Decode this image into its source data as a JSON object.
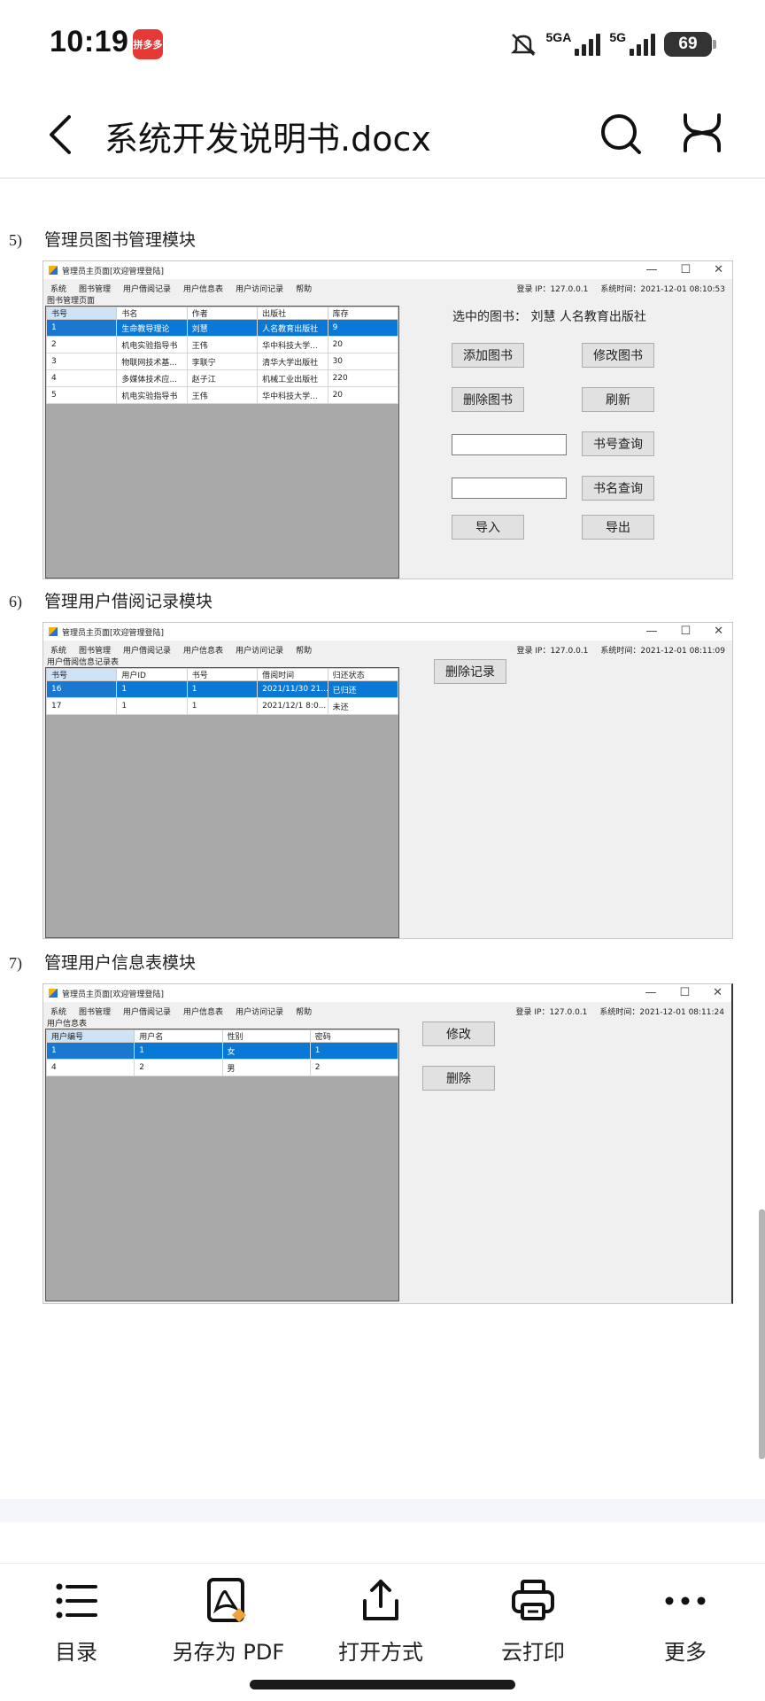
{
  "status": {
    "time": "10:19",
    "app_badge": "拼多多",
    "net1": "5GA",
    "net2": "5G",
    "battery": "69"
  },
  "header": {
    "title": "系统开发说明书.docx"
  },
  "sections": [
    {
      "number": "5)",
      "title": "管理员图书管理模块",
      "window": {
        "title": "管理员主页面[欢迎管理登陆]",
        "menu": [
          "系统",
          "图书管理",
          "用户借阅记录",
          "用户信息表",
          "用户访问记录",
          "帮助"
        ],
        "login_ip": "登录 IP：127.0.0.1",
        "sys_time": "系统时间：2021-12-01 08:10:53",
        "page_label": "图书管理页面",
        "columns": [
          "书号",
          "书名",
          "作者",
          "出版社",
          "库存"
        ],
        "rows": [
          [
            "1",
            "生命教导理论",
            "刘慧",
            "人名教育出版社",
            "9"
          ],
          [
            "2",
            "机电实验指导书",
            "王伟",
            "华中科技大学...",
            "20"
          ],
          [
            "3",
            "物联网技术基...",
            "李联宁",
            "清华大学出版社",
            "30"
          ],
          [
            "4",
            "多媒体技术应...",
            "赵子江",
            "机械工业出版社",
            "220"
          ],
          [
            "5",
            "机电实验指导书",
            "王伟",
            "华中科技大学...",
            "20"
          ]
        ],
        "selected_label": "选中的图书：  刘慧 人名教育出版社",
        "buttons": [
          "添加图书",
          "修改图书",
          "删除图书",
          "刷新",
          "书号查询",
          "书名查询",
          "导入",
          "导出"
        ]
      }
    },
    {
      "number": "6)",
      "title": "管理用户借阅记录模块",
      "window": {
        "title": "管理员主页面[欢迎管理登陆]",
        "menu": [
          "系统",
          "图书管理",
          "用户借阅记录",
          "用户信息表",
          "用户访问记录",
          "帮助"
        ],
        "login_ip": "登录 IP：127.0.0.1",
        "sys_time": "系统时间：2021-12-01 08:11:09",
        "page_label": "用户借阅信息记录表",
        "columns": [
          "书号",
          "用户ID",
          "书号",
          "借阅时间",
          "归还状态"
        ],
        "rows": [
          [
            "16",
            "1",
            "1",
            "2021/11/30 21...",
            "已归还"
          ],
          [
            "17",
            "1",
            "1",
            "2021/12/1 8:0...",
            "未还"
          ]
        ],
        "buttons": [
          "删除记录"
        ]
      }
    },
    {
      "number": "7)",
      "title": "管理用户信息表模块",
      "window": {
        "title": "管理员主页面[欢迎管理登陆]",
        "menu": [
          "系统",
          "图书管理",
          "用户借阅记录",
          "用户信息表",
          "用户访问记录",
          "帮助"
        ],
        "login_ip": "登录 IP：127.0.0.1",
        "sys_time": "系统时间：2021-12-01 08:11:24",
        "page_label": "用户信息表",
        "columns": [
          "用户编号",
          "用户名",
          "性别",
          "密码"
        ],
        "rows": [
          [
            "1",
            "1",
            "女",
            "1"
          ],
          [
            "4",
            "2",
            "男",
            "2"
          ]
        ],
        "buttons": [
          "修改",
          "删除"
        ]
      }
    }
  ],
  "toolbar": {
    "items": [
      "目录",
      "另存为 PDF",
      "打开方式",
      "云打印",
      "更多"
    ]
  }
}
